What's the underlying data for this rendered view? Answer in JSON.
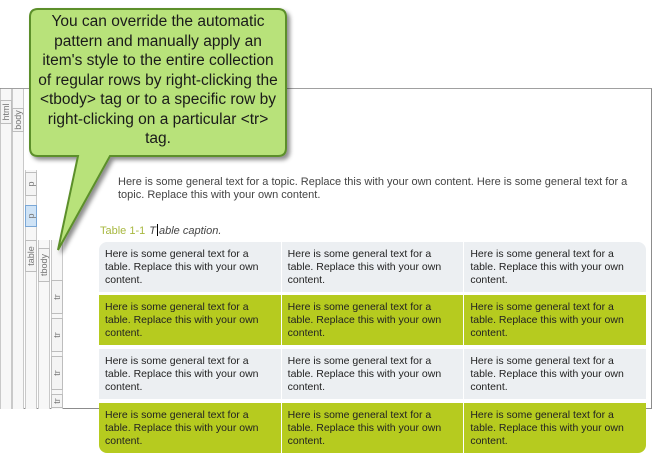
{
  "callout": {
    "text": "You can override the automatic pattern and manually apply an item's style to the entire collection of regular rows by right-clicking the <tbody> tag or to a specific row by right-clicking on a particular <tr> tag."
  },
  "structure_bars": {
    "html": "html",
    "body": "body",
    "p1": "p",
    "p2": "p",
    "table": "table",
    "tbody": "tbody",
    "tr1": "tr",
    "tr2": "tr",
    "tr3": "tr",
    "tr4": "tr"
  },
  "document": {
    "paragraph": "Here is some general text for a topic. Replace this with your own content. Here is some general text for a topic. Replace this with your own content.",
    "caption_label": "Table 1-1",
    "caption_before_cursor": "T",
    "caption_after_cursor": "able caption."
  },
  "table": {
    "rows": [
      [
        "Here is some general text for a table. Replace this with your own content.",
        "Here is some general text for a table. Replace this with your own content.",
        "Here is some general text for a table. Replace this with your own content."
      ],
      [
        "Here is some general text for a table. Replace this with your own content.",
        "Here is some general text for a table. Replace this with your own content.",
        "Here is some general text for a table. Replace this with your own content."
      ],
      [
        "Here is some general text for a table. Replace this with your own content.",
        "Here is some general text for a table. Replace this with your own content.",
        "Here is some general text for a table. Replace this with your own content."
      ],
      [
        "Here is some general text for a table. Replace this with your own content.",
        "Here is some general text for a table. Replace this with your own content.",
        "Here is some general text for a table. Replace this with your own content."
      ]
    ]
  },
  "colors": {
    "callout_fill": "#b8e27a",
    "row_light": "#eceff2",
    "row_accent": "#b6cb1f",
    "caption_label": "#a8b840"
  }
}
